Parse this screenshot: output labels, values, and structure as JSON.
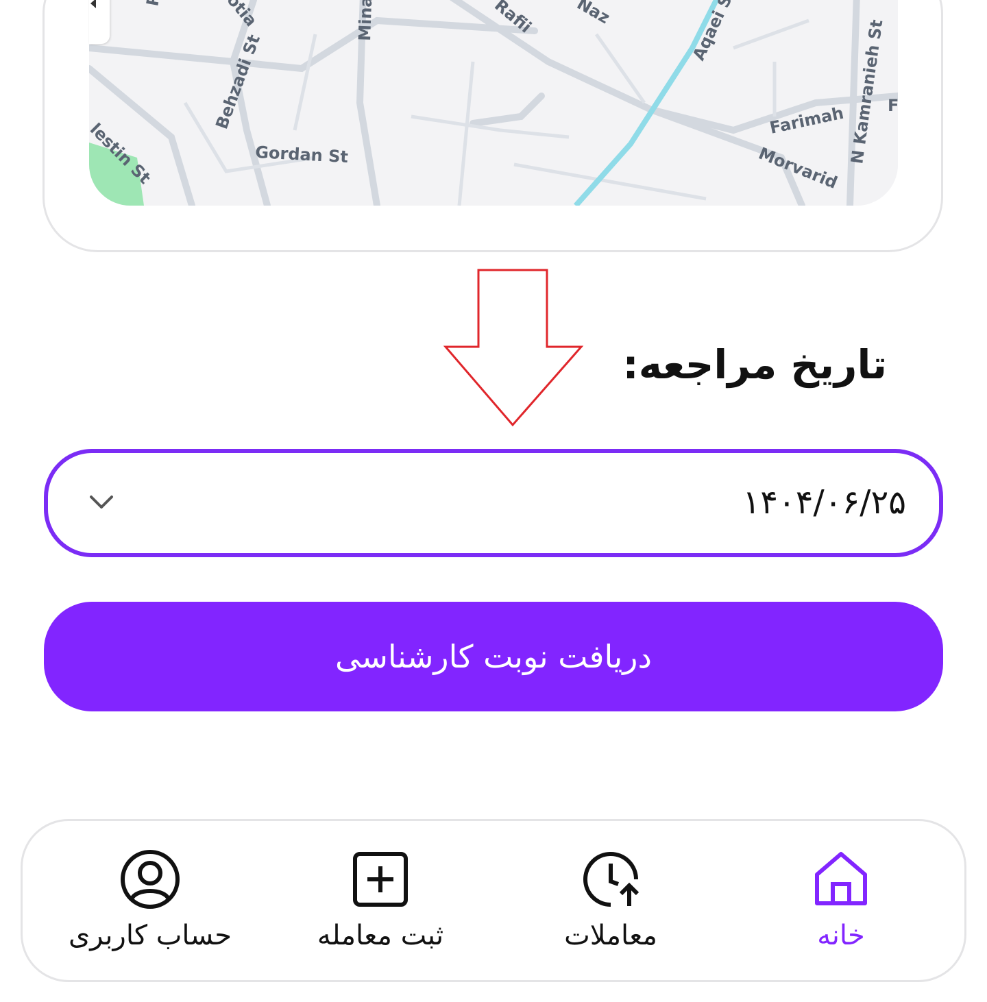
{
  "map": {
    "streets": [
      "Ra",
      "otia",
      "Mina",
      "Rafii",
      "Naz",
      "Aqaei St",
      "Behzadi St",
      "Gordan St",
      "Farimah",
      "N Kamranieh St",
      "Morvarid",
      "lestin St",
      "F"
    ]
  },
  "form": {
    "date_label": "تاریخ مراجعه:",
    "date_value": "۱۴۰۴/۰۶/۲۵"
  },
  "cta": {
    "label": "دریافت نوبت کارشناسی"
  },
  "nav": {
    "items": [
      {
        "label": "حساب کاربری",
        "icon": "user-circle-icon"
      },
      {
        "label": "ثبت معامله",
        "icon": "plus-square-icon"
      },
      {
        "label": "معاملات",
        "icon": "clock-arrow-icon"
      },
      {
        "label": "خانه",
        "icon": "home-icon",
        "active": true
      }
    ]
  },
  "colors": {
    "accent": "#8225ff",
    "arrow": "#e0262b"
  }
}
